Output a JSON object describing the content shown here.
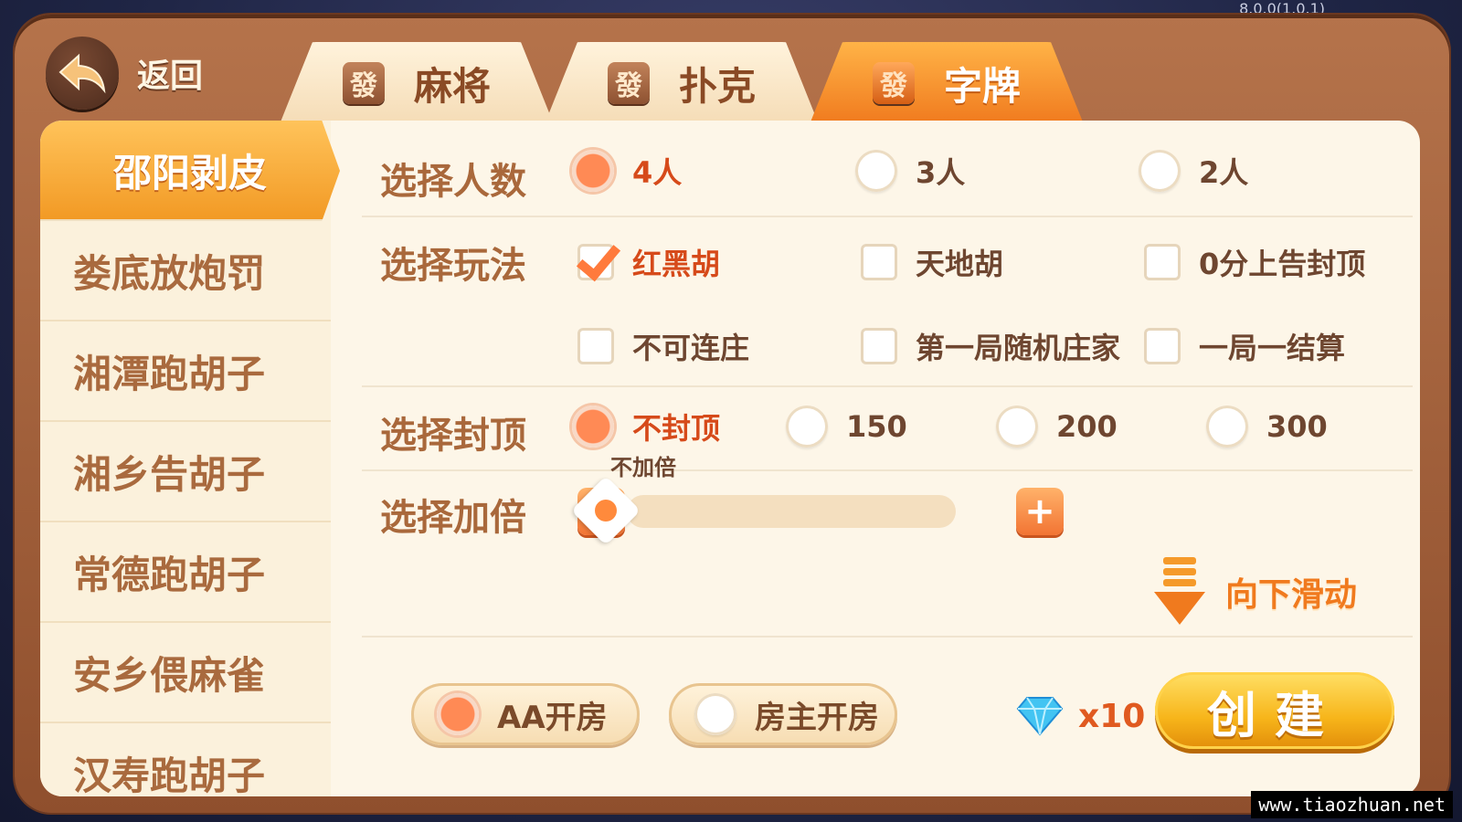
{
  "version": "8.0.0(1.0.1)",
  "watermark": "www.tiaozhuan.net",
  "header": {
    "back_label": "返回",
    "tabs": [
      {
        "icon_text": "發",
        "label": "麻将",
        "active": false
      },
      {
        "icon_text": "發",
        "label": "扑克",
        "active": false
      },
      {
        "icon_text": "發",
        "label": "字牌",
        "active": true
      }
    ]
  },
  "sidebar": {
    "items": [
      {
        "label": "邵阳剥皮",
        "active": true
      },
      {
        "label": "娄底放炮罚"
      },
      {
        "label": "湘潭跑胡子"
      },
      {
        "label": "湘乡告胡子"
      },
      {
        "label": "常德跑胡子"
      },
      {
        "label": "安乡偎麻雀"
      },
      {
        "label": "汉寿跑胡子"
      }
    ]
  },
  "settings": {
    "players": {
      "label": "选择人数",
      "options": [
        {
          "label": "4人",
          "selected": true
        },
        {
          "label": "3人",
          "selected": false
        },
        {
          "label": "2人",
          "selected": false
        }
      ]
    },
    "play_mode": {
      "label": "选择玩法",
      "options": [
        {
          "label": "红黑胡",
          "checked": true
        },
        {
          "label": "天地胡",
          "checked": false
        },
        {
          "label": "0分上告封顶",
          "checked": false
        },
        {
          "label": "不可连庄",
          "checked": false
        },
        {
          "label": "第一局随机庄家",
          "checked": false
        },
        {
          "label": "一局一结算",
          "checked": false
        }
      ]
    },
    "cap": {
      "label": "选择封顶",
      "options": [
        {
          "label": "不封顶",
          "selected": true
        },
        {
          "label": "150",
          "selected": false
        },
        {
          "label": "200",
          "selected": false
        },
        {
          "label": "300",
          "selected": false
        }
      ]
    },
    "multiplier": {
      "label": "选择加倍",
      "value_label": "不加倍",
      "minus": "−",
      "plus": "+",
      "level": 0
    }
  },
  "scroll_hint": "向下滑动",
  "payment": {
    "options": [
      {
        "label": "AA开房",
        "selected": true
      },
      {
        "label": "房主开房",
        "selected": false
      }
    ]
  },
  "cost": {
    "label": "x10",
    "icon": "diamond-icon"
  },
  "create_label": "创建",
  "colors": {
    "accent": "#f07a1e",
    "frame": "#a8653f",
    "panel": "#fdf6e8"
  }
}
